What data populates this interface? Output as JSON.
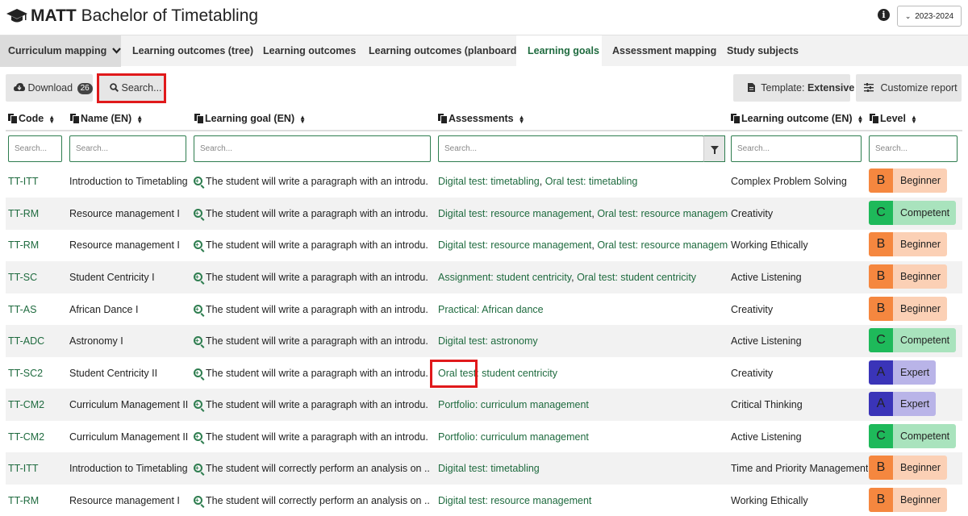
{
  "header": {
    "title_bold": "MATT",
    "title_rest": "Bachelor of Timetabling",
    "year": "2023-2024"
  },
  "tabs": [
    {
      "label": "Curriculum mapping"
    },
    {
      "label": "Learning outcomes (tree)"
    },
    {
      "label": "Learning outcomes"
    },
    {
      "label": "Learning outcomes (planboard)"
    },
    {
      "label": "Learning goals"
    },
    {
      "label": "Assessment mapping"
    },
    {
      "label": "Study subjects"
    }
  ],
  "toolbar": {
    "download_label": "Download",
    "download_count": "26",
    "search_label": "Search...",
    "template_label": "Template:",
    "template_value": "Extensive",
    "customize_label": "Customize report"
  },
  "columns": {
    "code": "Code",
    "name": "Name (EN)",
    "goal": "Learning goal (EN)",
    "assessments": "Assessments",
    "outcome": "Learning outcome (EN)",
    "level": "Level"
  },
  "filter_placeholder": "Search...",
  "levels": {
    "B": {
      "label": "Beginner",
      "letter_bg": "#f5873f",
      "label_bg": "#fbd0b5"
    },
    "C": {
      "label": "Competent",
      "letter_bg": "#1eb95a",
      "label_bg": "#a9e3bd"
    },
    "A": {
      "label": "Expert",
      "letter_bg": "#3a34b8",
      "label_bg": "#b9b4e8"
    }
  },
  "rows": [
    {
      "code": "TT-ITT",
      "name": "Introduction to Timetabling",
      "goal": "The student will write a paragraph with an introdu...",
      "assessments": [
        "Digital test: timetabling",
        "Oral test: timetabling"
      ],
      "outcome": "Complex Problem Solving",
      "level": "B"
    },
    {
      "code": "TT-RM",
      "name": "Resource management I",
      "goal": "The student will write a paragraph with an introdu...",
      "assessments": [
        "Digital test: resource management",
        "Oral test: resource management"
      ],
      "outcome": "Creativity",
      "level": "C"
    },
    {
      "code": "TT-RM",
      "name": "Resource management I",
      "goal": "The student will write a paragraph with an introdu...",
      "assessments": [
        "Digital test: resource management",
        "Oral test: resource management"
      ],
      "outcome": "Working Ethically",
      "level": "B"
    },
    {
      "code": "TT-SC",
      "name": "Student Centricity I",
      "goal": "The student will write a paragraph with an introdu...",
      "assessments": [
        "Assignment: student centricity",
        "Oral test: student centricity"
      ],
      "outcome": "Active Listening",
      "level": "B"
    },
    {
      "code": "TT-AS",
      "name": "African Dance I",
      "goal": "The student will write a paragraph with an introdu...",
      "assessments": [
        "Practical: African dance"
      ],
      "outcome": "Creativity",
      "level": "B"
    },
    {
      "code": "TT-ADC",
      "name": "Astronomy I",
      "goal": "The student will write a paragraph with an introdu...",
      "assessments": [
        "Digital test: astronomy"
      ],
      "outcome": "Active Listening",
      "level": "C"
    },
    {
      "code": "TT-SC2",
      "name": "Student Centricity II",
      "goal": "The student will write a paragraph with an introdu...",
      "assessments": [
        "Oral test: student centricity"
      ],
      "outcome": "Creativity",
      "level": "A"
    },
    {
      "code": "TT-CM2",
      "name": "Curriculum Management II",
      "goal": "The student will write a paragraph with an introdu...",
      "assessments": [
        "Portfolio: curriculum management"
      ],
      "outcome": "Critical Thinking",
      "level": "A"
    },
    {
      "code": "TT-CM2",
      "name": "Curriculum Management II",
      "goal": "The student will write a paragraph with an introdu...",
      "assessments": [
        "Portfolio: curriculum management"
      ],
      "outcome": "Active Listening",
      "level": "C"
    },
    {
      "code": "TT-ITT",
      "name": "Introduction to Timetabling",
      "goal": "The student will correctly perform an analysis on ...",
      "assessments": [
        "Digital test: timetabling"
      ],
      "outcome": "Time and Priority Management",
      "level": "B"
    },
    {
      "code": "TT-RM",
      "name": "Resource management I",
      "goal": "The student will correctly perform an analysis on ...",
      "assessments": [
        "Digital test: resource management"
      ],
      "outcome": "Working Ethically",
      "level": "B"
    }
  ]
}
